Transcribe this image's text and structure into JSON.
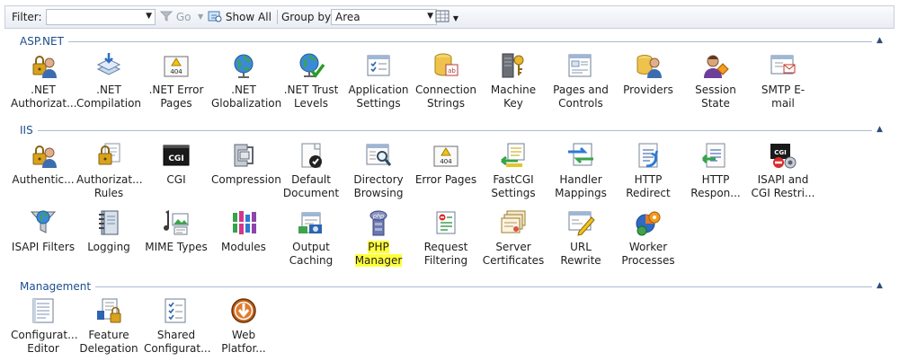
{
  "toolbar": {
    "filter_label": "Filter:",
    "filter_value": "",
    "go_label": "Go",
    "show_all_label": "Show All",
    "group_by_label": "Group by:",
    "group_by_value": "Area"
  },
  "sections": [
    {
      "title": "ASP.NET",
      "items": [
        {
          "label": ".NET\nAuthorizat...",
          "icon": "lock-user-icon"
        },
        {
          "label": ".NET\nCompilation",
          "icon": "compile-stack-icon"
        },
        {
          "label": ".NET Error\nPages",
          "icon": "error-404-icon"
        },
        {
          "label": ".NET\nGlobalization",
          "icon": "globe-icon"
        },
        {
          "label": ".NET Trust\nLevels",
          "icon": "globe-check-icon"
        },
        {
          "label": "Application\nSettings",
          "icon": "settings-list-icon"
        },
        {
          "label": "Connection\nStrings",
          "icon": "database-icon"
        },
        {
          "label": "Machine Key",
          "icon": "key-server-icon"
        },
        {
          "label": "Pages and\nControls",
          "icon": "pages-controls-icon"
        },
        {
          "label": "Providers",
          "icon": "providers-icon"
        },
        {
          "label": "Session State",
          "icon": "user-diamond-icon"
        },
        {
          "label": "SMTP E-mail",
          "icon": "email-icon"
        }
      ]
    },
    {
      "title": "IIS",
      "items": [
        {
          "label": "Authentic...",
          "icon": "lock-user-icon"
        },
        {
          "label": "Authorizat...\nRules",
          "icon": "lock-doc-icon"
        },
        {
          "label": "CGI",
          "icon": "cgi-icon"
        },
        {
          "label": "Compression",
          "icon": "clamp-icon"
        },
        {
          "label": "Default\nDocument",
          "icon": "default-document-icon"
        },
        {
          "label": "Directory\nBrowsing",
          "icon": "directory-browse-icon"
        },
        {
          "label": "Error Pages",
          "icon": "error-404-icon"
        },
        {
          "label": "FastCGI\nSettings",
          "icon": "fastcgi-icon"
        },
        {
          "label": "Handler\nMappings",
          "icon": "handler-arrows-icon"
        },
        {
          "label": "HTTP\nRedirect",
          "icon": "redirect-icon"
        },
        {
          "label": "HTTP\nRespon...",
          "icon": "http-response-icon"
        },
        {
          "label": "ISAPI and\nCGI Restri...",
          "icon": "isapi-cgi-icon"
        },
        {
          "label": "ISAPI Filters",
          "icon": "filter-globe-icon"
        },
        {
          "label": "Logging",
          "icon": "log-notebook-icon"
        },
        {
          "label": "MIME Types",
          "icon": "mime-icon"
        },
        {
          "label": "Modules",
          "icon": "modules-icon"
        },
        {
          "label": "Output\nCaching",
          "icon": "output-cache-icon"
        },
        {
          "label": "PHP\nManager",
          "icon": "php-icon"
        },
        {
          "label": "Request\nFiltering",
          "icon": "request-filter-icon"
        },
        {
          "label": "Server\nCertificates",
          "icon": "certificates-icon"
        },
        {
          "label": "URL Rewrite",
          "icon": "url-rewrite-icon"
        },
        {
          "label": "Worker\nProcesses",
          "icon": "worker-processes-icon"
        }
      ]
    },
    {
      "title": "Management",
      "items": [
        {
          "label": "Configurat...\nEditor",
          "icon": "config-editor-icon"
        },
        {
          "label": "Feature\nDelegation",
          "icon": "delegation-icon"
        },
        {
          "label": "Shared\nConfigurat...",
          "icon": "shared-config-icon"
        },
        {
          "label": "Web\nPlatfor...",
          "icon": "web-platform-icon"
        }
      ]
    }
  ],
  "highlight_color": "#ffff3b",
  "accent_color": "#1d4d8c"
}
